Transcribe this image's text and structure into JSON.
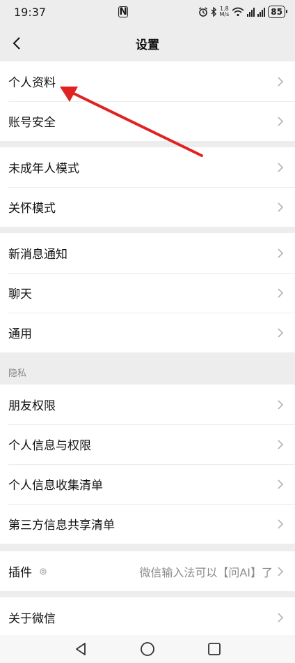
{
  "status": {
    "time": "19:37",
    "network_speed_value": "1.8",
    "network_speed_unit": "M/s",
    "battery": "85"
  },
  "nav": {
    "title": "设置"
  },
  "groups": [
    {
      "items": [
        "个人资料",
        "账号安全"
      ]
    },
    {
      "items": [
        "未成年人模式",
        "关怀模式"
      ]
    },
    {
      "items": [
        "新消息通知",
        "聊天",
        "通用"
      ]
    },
    {
      "section_label": "隐私",
      "items": [
        "朋友权限",
        "个人信息与权限",
        "个人信息收集清单",
        "第三方信息共享清单"
      ]
    },
    {
      "items": [
        {
          "label": "插件",
          "value": "微信输入法可以【问AI】了"
        }
      ]
    },
    {
      "items": [
        "关于微信"
      ]
    }
  ],
  "annotation": {
    "arrow_color": "#e02222"
  }
}
